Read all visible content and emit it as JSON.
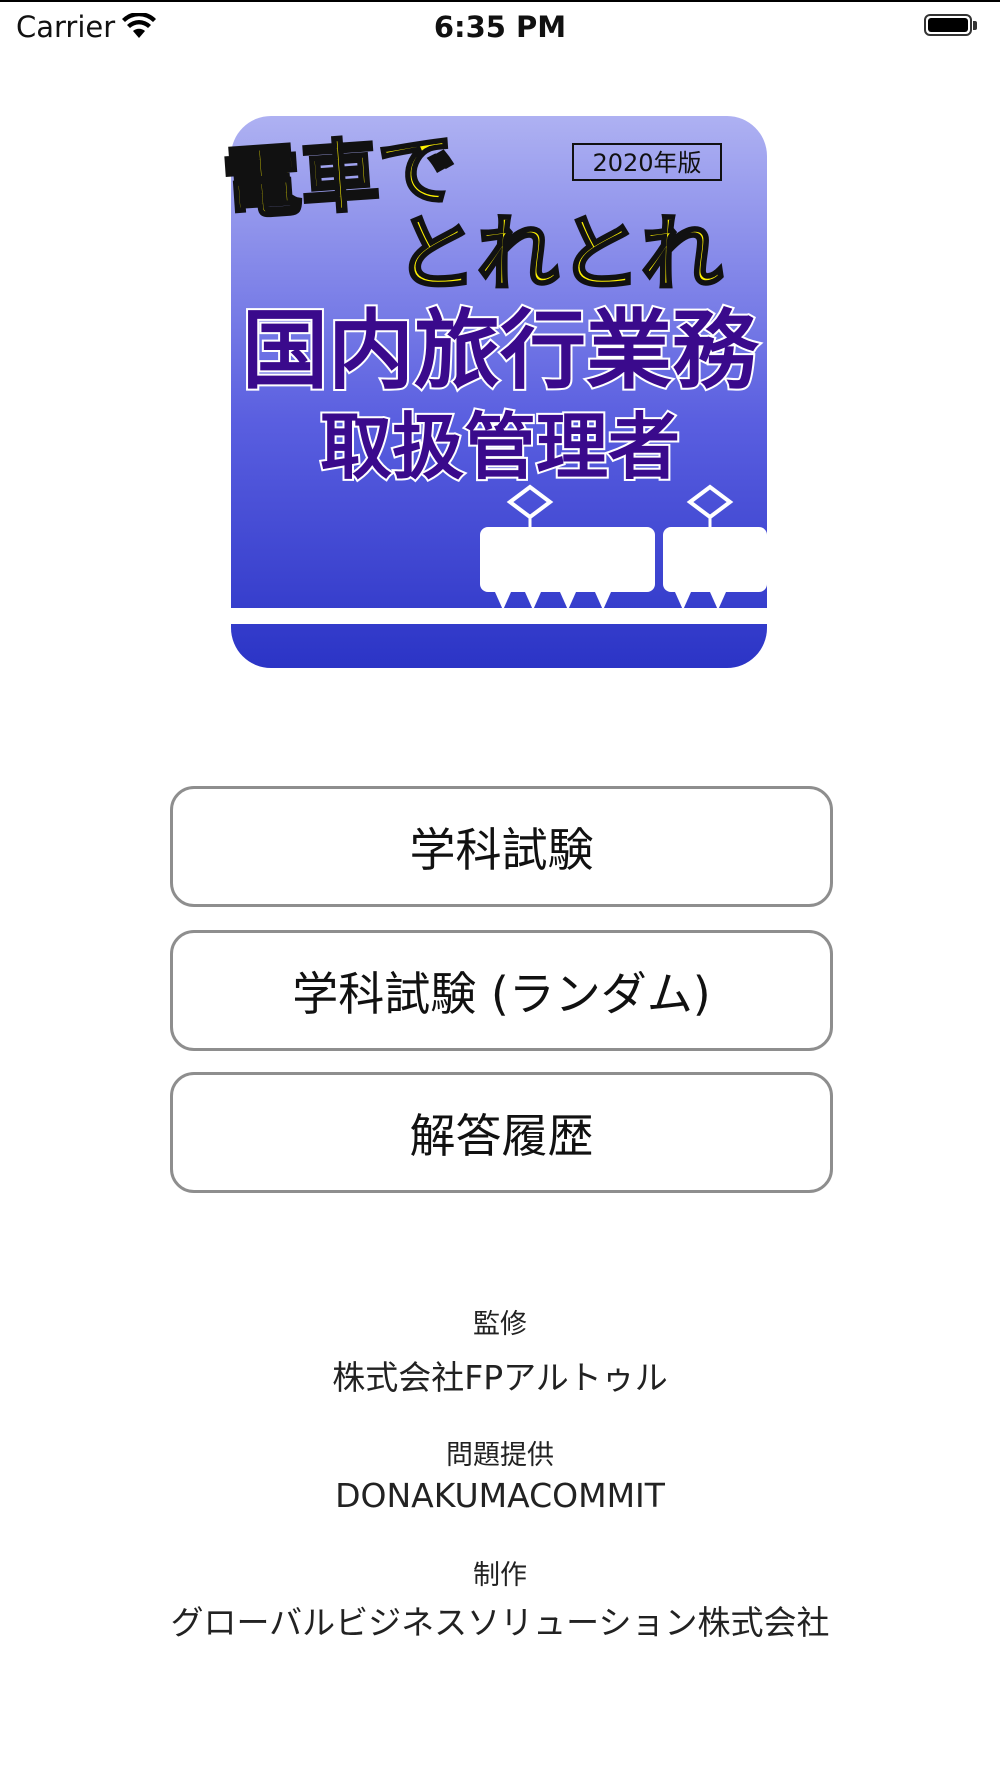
{
  "status_bar": {
    "carrier": "Carrier",
    "time": "6:35 PM"
  },
  "logo": {
    "line1": "電車で",
    "line2": "とれとれ",
    "edition": "2020年版",
    "title1": "国内旅行業務",
    "title2": "取扱管理者",
    "colors": {
      "top": "#a8acf0",
      "bottom": "#2c35c8",
      "yellow": "#fff200",
      "purple": "#3a0a8c"
    }
  },
  "menu": [
    {
      "label": "学科試験"
    },
    {
      "label": "学科試験 (ランダム)"
    },
    {
      "label": "解答履歴"
    }
  ],
  "credits": {
    "supervision_label": "監修",
    "supervision_value": "株式会社FPアルトゥル",
    "provider_label": "問題提供",
    "provider_value": "DONAKUMACOMMIT",
    "production_label": "制作",
    "production_value": "グローバルビジネスソリューション株式会社"
  }
}
